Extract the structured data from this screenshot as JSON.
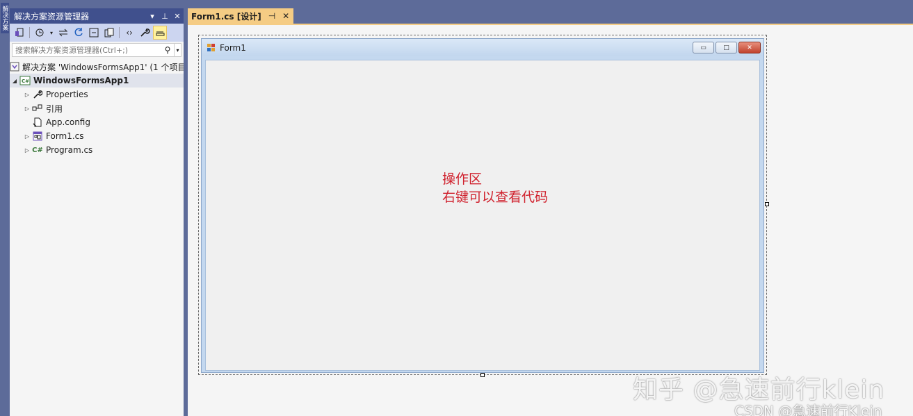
{
  "left_strip": {
    "label": "解决方案"
  },
  "solution_explorer": {
    "title": "解决方案资源管理器",
    "pin_glyph": "⊥",
    "dropdown_glyph": "▾",
    "close_glyph": "✕",
    "search": {
      "placeholder": "搜索解决方案资源管理器(Ctrl+;)"
    },
    "tree": [
      {
        "label": "解决方案 'WindowsFormsApp1' (1 个项目",
        "icon": "solution-icon",
        "arrow": ""
      },
      {
        "label": "WindowsFormsApp1",
        "icon": "csharp-project-icon",
        "arrow": "◢"
      },
      {
        "label": "Properties",
        "icon": "wrench-icon",
        "arrow": "▷"
      },
      {
        "label": "引用",
        "icon": "references-icon",
        "arrow": "▷"
      },
      {
        "label": "App.config",
        "icon": "config-file-icon",
        "arrow": ""
      },
      {
        "label": "Form1.cs",
        "icon": "form-file-icon",
        "arrow": "▷"
      },
      {
        "label": "Program.cs",
        "icon": "csharp-file-icon",
        "arrow": "▷"
      }
    ]
  },
  "document": {
    "tab": {
      "label": "Form1.cs [设计]",
      "pin": "⊣",
      "close": "✕"
    }
  },
  "form": {
    "title": "Form1",
    "minimize": "▭",
    "maximize": "□",
    "close": "✕",
    "annotation_line1": "操作区",
    "annotation_line2": "右键可以查看代码"
  },
  "watermark": {
    "zhihu": "知乎 @急速前行klein",
    "csdn": "CSDN @急速前行Klein"
  },
  "colors": {
    "chrome": "#5d6b99",
    "panel_title": "#40508d",
    "active_tab": "#f5cc84",
    "annotation": "#d0222e"
  }
}
